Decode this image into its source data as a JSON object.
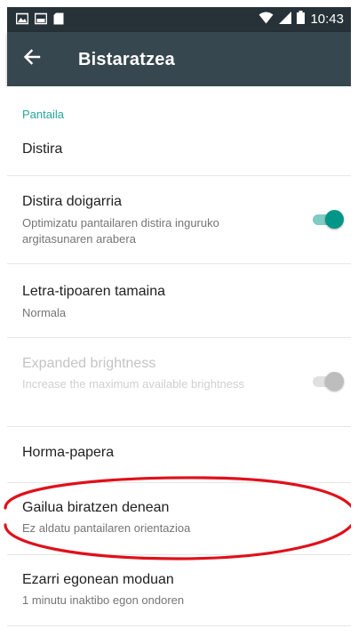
{
  "status_bar": {
    "time": "10:43",
    "left_icons": [
      "image-icon",
      "screenshot-icon",
      "sd-card-icon"
    ],
    "right_icons": [
      "wifi-icon",
      "cell-signal-icon",
      "battery-icon"
    ]
  },
  "app_bar": {
    "back_icon": "arrow-back-icon",
    "title": "Bistaratzea"
  },
  "section": {
    "header": "Pantaila"
  },
  "settings": {
    "brightness": {
      "title": "Distira"
    },
    "adaptive_brightness": {
      "title": "Distira doigarria",
      "summary": "Optimizatu pantailaren distira inguruko argitasunaren arabera",
      "toggle": "on"
    },
    "font_size": {
      "title": "Letra-tipoaren tamaina",
      "summary": "Normala"
    },
    "expanded_brightness": {
      "title": "Expanded brightness",
      "summary": "Increase the maximum available brightness",
      "toggle": "off",
      "enabled": false
    },
    "wallpaper": {
      "title": "Horma-papera"
    },
    "rotation": {
      "title": "Gailua biratzen denean",
      "summary": "Ez aldatu pantailaren orientazioa"
    },
    "sleep": {
      "title": "Ezarri egonean moduan",
      "summary": "1 minutu inaktibo egon ondoren"
    }
  },
  "colors": {
    "status_bar": "#263238",
    "app_bar": "#37474f",
    "accent": "#009688",
    "annotation": "#e0101a"
  }
}
